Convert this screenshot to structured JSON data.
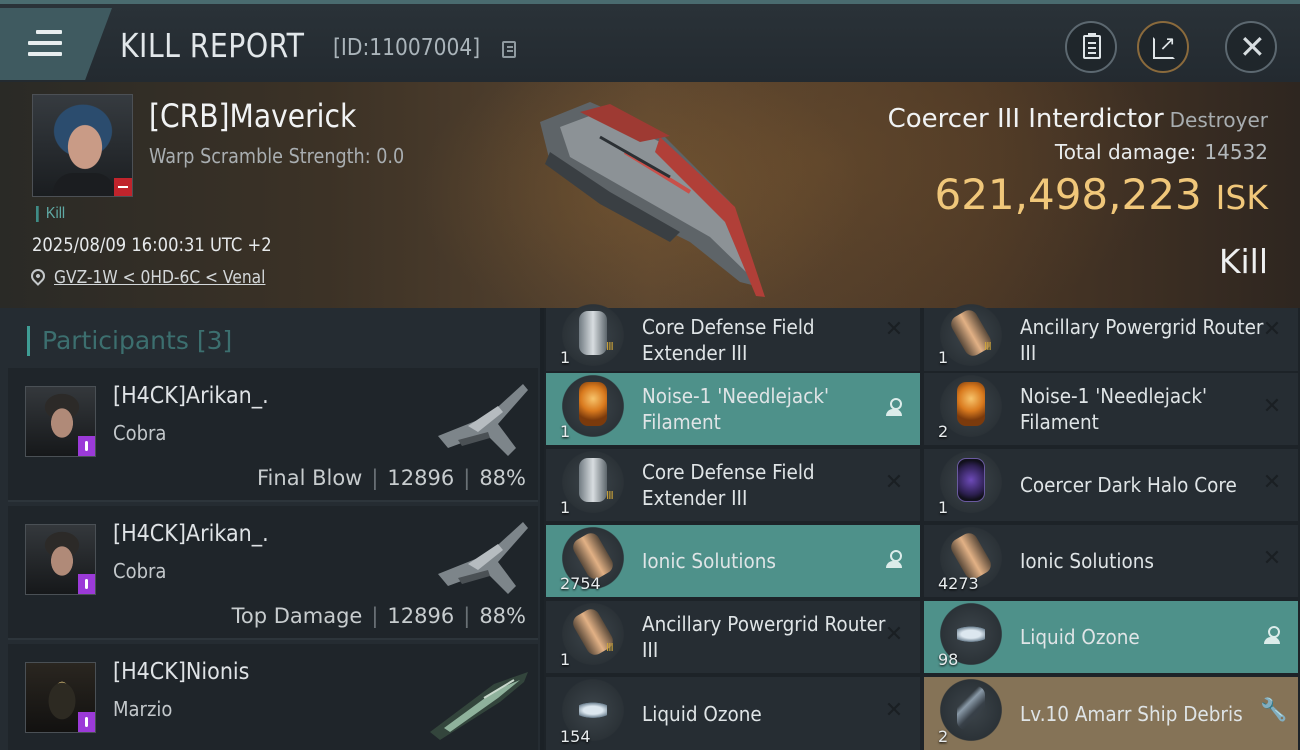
{
  "header": {
    "title": "KILL REPORT",
    "report_id": "[ID:11007004]"
  },
  "victim": {
    "name": "[CRB]Maverick",
    "warp_scramble": "Warp Scramble Strength: 0.0",
    "kill_tag": "Kill",
    "timestamp": "2025/08/09 16:00:31 UTC +2",
    "location": "GVZ-1W < 0HD-6C < Venal",
    "ship_name": "Coercer III Interdictor",
    "ship_class": "Destroyer",
    "total_damage_label": "Total damage:",
    "total_damage": "14532",
    "isk_value": "621,498,223",
    "isk_unit": "ISK",
    "result": "Kill"
  },
  "participants": {
    "label": "Participants",
    "count": "[3]",
    "list": [
      {
        "name": "[H4CK]Arikan_.",
        "ship": "Cobra",
        "role": "Final Blow",
        "damage": "12896",
        "percent": "88%"
      },
      {
        "name": "[H4CK]Arikan_.",
        "ship": "Cobra",
        "role": "Top Damage",
        "damage": "12896",
        "percent": "88%"
      },
      {
        "name": "[H4CK]Nionis",
        "ship": "Marzio"
      }
    ]
  },
  "items": [
    {
      "label": "Core Defense Field Extender III",
      "qty": "1",
      "tier": "III",
      "icon": "shield-extender-icon",
      "state": "destroyed"
    },
    {
      "label": "Ancillary Powergrid Router III",
      "qty": "1",
      "tier": "III",
      "icon": "powergrid-router-icon",
      "state": "destroyed"
    },
    {
      "label": "Noise-1 'Needlejack' Filament",
      "qty": "1",
      "tier": "",
      "icon": "filament-icon",
      "state": "dropped"
    },
    {
      "label": "Noise-1 'Needlejack' Filament",
      "qty": "2",
      "tier": "",
      "icon": "filament-icon",
      "state": "destroyed"
    },
    {
      "label": "Core Defense Field Extender III",
      "qty": "1",
      "tier": "III",
      "icon": "shield-extender-icon",
      "state": "destroyed"
    },
    {
      "label": "Coercer Dark Halo Core",
      "qty": "1",
      "tier": "",
      "icon": "halo-core-icon",
      "state": "destroyed"
    },
    {
      "label": "Ionic Solutions",
      "qty": "2754",
      "tier": "",
      "icon": "ionic-solutions-icon",
      "state": "dropped"
    },
    {
      "label": "Ionic Solutions",
      "qty": "4273",
      "tier": "",
      "icon": "ionic-solutions-icon",
      "state": "destroyed"
    },
    {
      "label": "Ancillary Powergrid Router III",
      "qty": "1",
      "tier": "III",
      "icon": "powergrid-router-icon",
      "state": "destroyed"
    },
    {
      "label": "Liquid Ozone",
      "qty": "98",
      "tier": "",
      "icon": "liquid-ozone-icon",
      "state": "dropped"
    },
    {
      "label": "Liquid Ozone",
      "qty": "154",
      "tier": "",
      "icon": "liquid-ozone-icon",
      "state": "destroyed"
    },
    {
      "label": "Lv.10 Amarr Ship Debris",
      "qty": "2",
      "tier": "",
      "icon": "ship-debris-icon",
      "state": "salvage"
    }
  ],
  "colors": {
    "accent_teal": "#4e918a",
    "isk_gold": "#f0c77a",
    "salvage_gold": "#857357",
    "loss_red": "#c0242c"
  }
}
